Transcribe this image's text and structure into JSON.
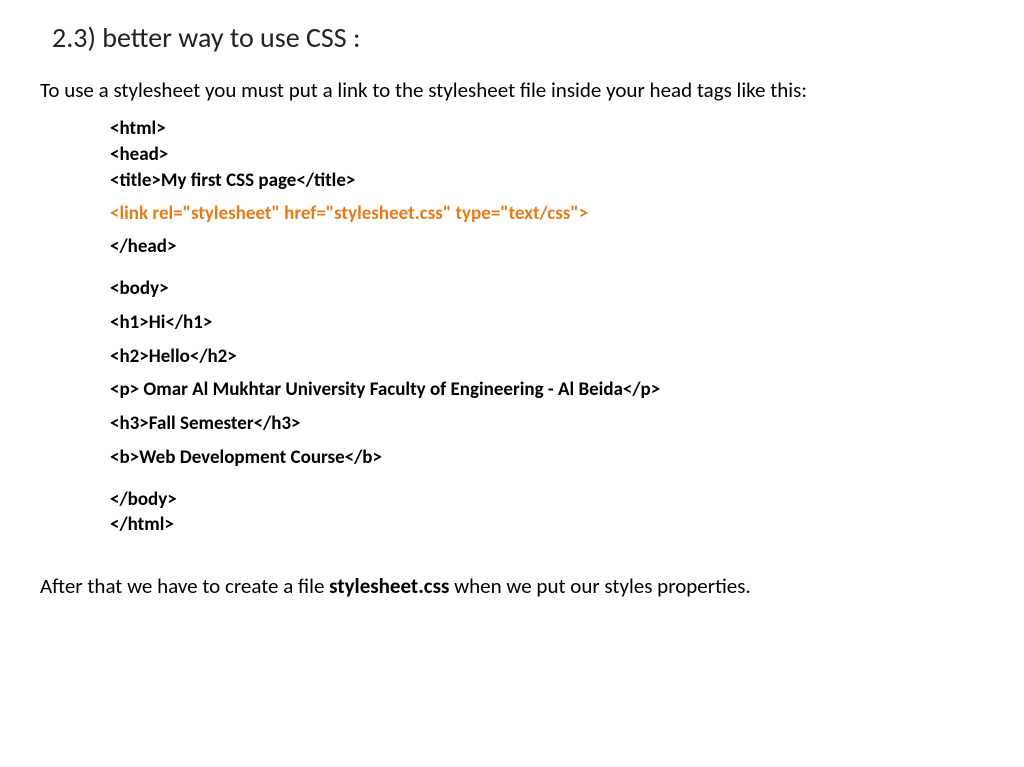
{
  "heading": "2.3) better way to use CSS :",
  "intro": "To use a stylesheet you must put a link to the stylesheet file inside your head tags like this:",
  "code": {
    "l1": "<html>",
    "l2": " <head>",
    "l3": "<title>My first CSS page</title>",
    "l4": "<link rel=\"stylesheet\" href=\"stylesheet.css\" type=\"text/css\">",
    "l5": "</head>",
    "l6": "<body>",
    "l7": "<h1>Hi</h1>",
    "l8": "<h2>Hello</h2>",
    "l9": "<p> Omar Al Mukhtar University Faculty of Engineering  -  Al Beida</p>",
    "l10": "<h3>Fall Semester</h3>",
    "l11": "<b>Web Development Course</b>",
    "l12": "</body>",
    "l13": " </html>"
  },
  "outro_pre": "After that we have to create a file ",
  "outro_bold": "stylesheet.css",
  "outro_post": " when we put our styles properties."
}
